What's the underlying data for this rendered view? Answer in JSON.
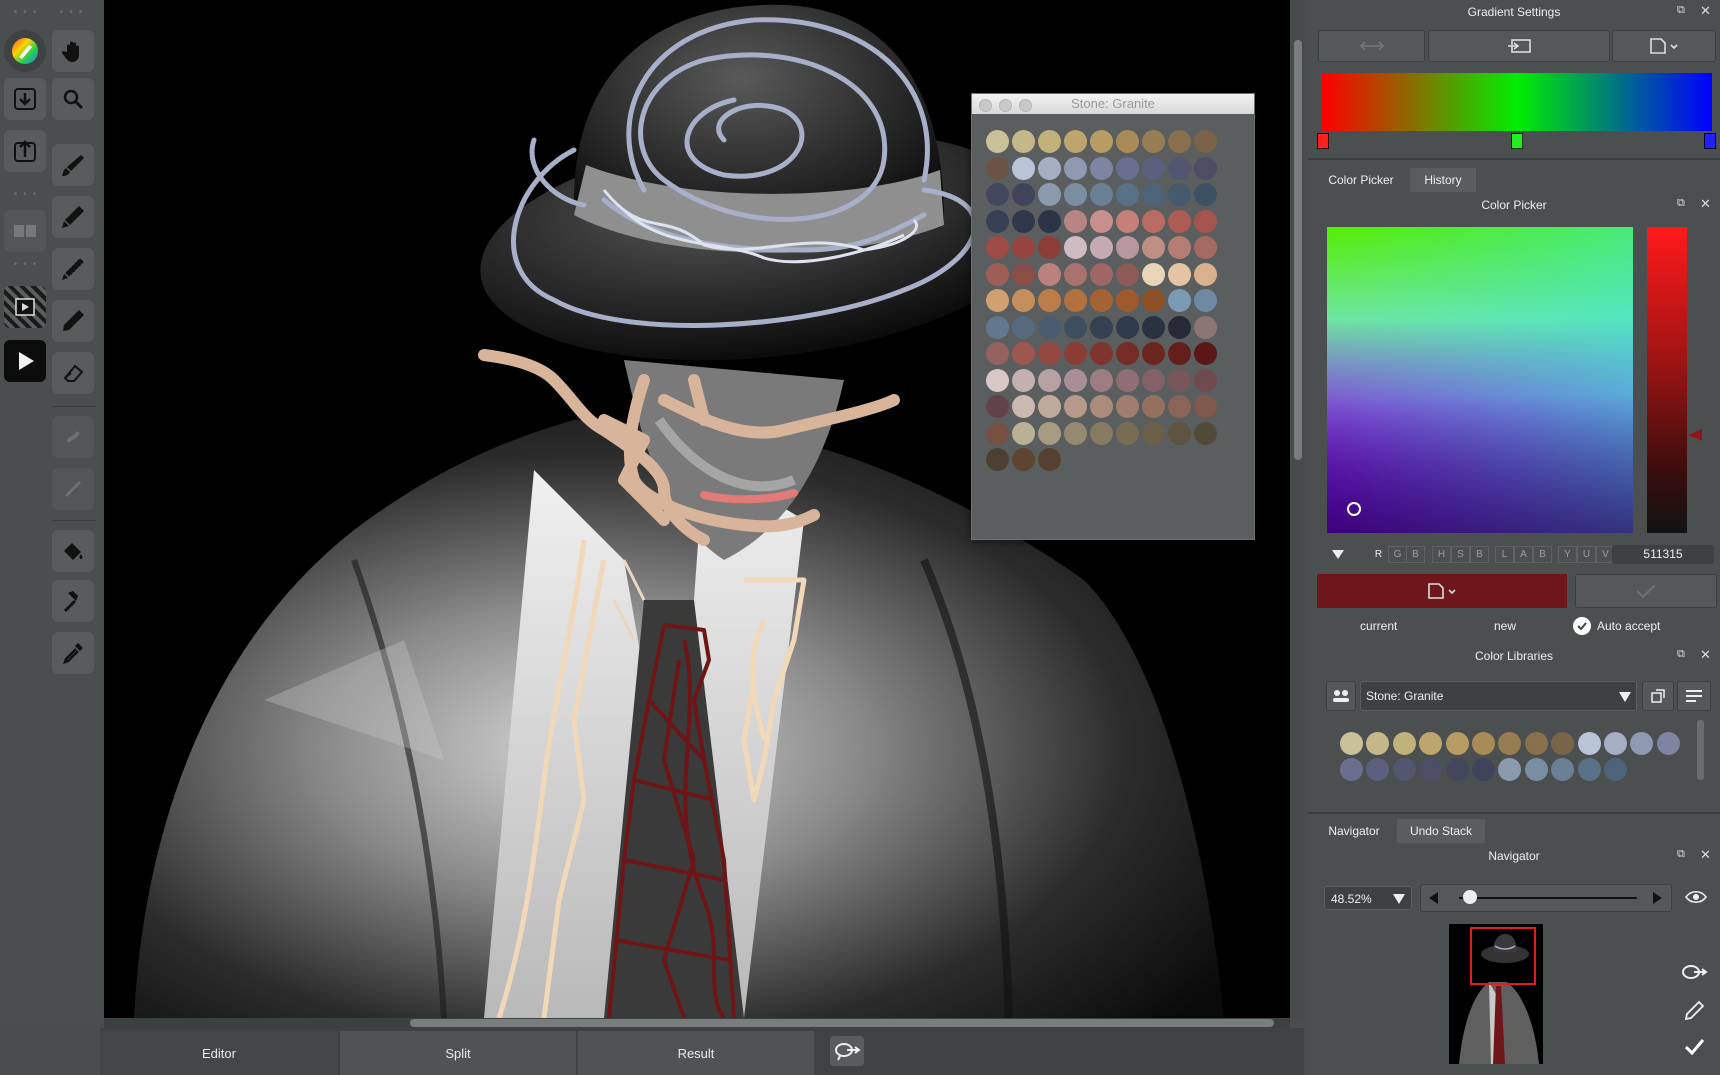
{
  "bottom_tabs": {
    "editor": "Editor",
    "split": "Split",
    "result": "Result"
  },
  "gradient": {
    "title": "Gradient Settings"
  },
  "color_picker": {
    "tabs": [
      "Color Picker",
      "History"
    ],
    "title": "Color Picker",
    "modes": [
      "R",
      "G",
      "B",
      "H",
      "S",
      "B",
      "L",
      "A",
      "B",
      "Y",
      "U",
      "V"
    ],
    "hex_value": "511315",
    "current_label": "current",
    "new_label": "new",
    "auto_accept_label": "Auto accept",
    "current_color": "#6e1619"
  },
  "color_libraries": {
    "title": "Color Libraries",
    "selected": "Stone: Granite"
  },
  "navigator": {
    "tabs": [
      "Navigator",
      "Undo Stack"
    ],
    "title": "Navigator",
    "zoom": "48.52%"
  },
  "swatch_window": {
    "title": "Stone: Granite",
    "swatches": [
      "#c9c19a",
      "#c4b889",
      "#c1b17b",
      "#bca66c",
      "#b89d63",
      "#a88c58",
      "#977d52",
      "#88704d",
      "#7a6449",
      "#6b5443",
      "#b9c4d6",
      "#a5aec2",
      "#8f99b1",
      "#7e84a2",
      "#6a6e8f",
      "#5c5f7e",
      "#53566f",
      "#4b4e64",
      "#43475c",
      "#40445a",
      "#8b9bab",
      "#7b8ea1",
      "#6b8094",
      "#597186",
      "#4d6478",
      "#455a6c",
      "#3e5162",
      "#373f52",
      "#30394b",
      "#2c3344",
      "#b98583",
      "#c7908f",
      "#c58179",
      "#b86c64",
      "#ad5c54",
      "#a5544f",
      "#9f4b45",
      "#95443e",
      "#8d3d38",
      "#cfbcc2",
      "#c4aab3",
      "#b8979f",
      "#bf8f86",
      "#b37d74",
      "#a56b63",
      "#9e5e57",
      "#8b4d47",
      "#bb817c",
      "#a9726d",
      "#9e6764",
      "#8c5b58",
      "#e8d5b8",
      "#e3c5a3",
      "#d8b28c",
      "#d1a071",
      "#c68e5d",
      "#bc7d4b",
      "#b3713f",
      "#a56232",
      "#9c5a2d",
      "#8c5025",
      "#7d9ab4",
      "#7089a3",
      "#61788f",
      "#566a7d",
      "#4a5c6d",
      "#3f4e5e",
      "#354050",
      "#2f3a4a",
      "#2a3240",
      "#262a36",
      "#8e7575",
      "#946360",
      "#9e5651",
      "#93493f",
      "#8a3d35",
      "#7f342d",
      "#762c26",
      "#6d2520",
      "#641e1b",
      "#5b1716",
      "#d7c8c7",
      "#c4b0b2",
      "#b6a1a4",
      "#a98f95",
      "#9c7d84",
      "#8f6e75",
      "#836166",
      "#78555a",
      "#6d4b50",
      "#62424a",
      "#c9b9b0",
      "#bfa99d",
      "#b59a8c",
      "#ab8b7c",
      "#a07d6e",
      "#957061",
      "#8a6456",
      "#7f594c",
      "#755043",
      "#b9b098",
      "#a69c83",
      "#958a71",
      "#857a62",
      "#776d55",
      "#6a604a",
      "#5d5441",
      "#524a39",
      "#4a4133",
      "#5e4532",
      "#56402f"
    ]
  },
  "library_swatches": [
    "#c9c19a",
    "#c4b889",
    "#c1b17b",
    "#bca66c",
    "#b89d63",
    "#a88c58",
    "#977d52",
    "#88704d",
    "#7a6449",
    "#b9c4d6",
    "#a5aec2",
    "#8f99b1",
    "#7e84a2",
    "#6a6e8f",
    "#5c5f7e",
    "#53566f",
    "#4b4e64",
    "#43475c",
    "#40445a",
    "#8b9bab",
    "#7b8ea1",
    "#6b8094",
    "#597186",
    "#4d6478"
  ],
  "colors": {
    "gradient_left": "#ff0000",
    "gradient_mid": "#00ee00",
    "gradient_right": "#0000ff"
  }
}
